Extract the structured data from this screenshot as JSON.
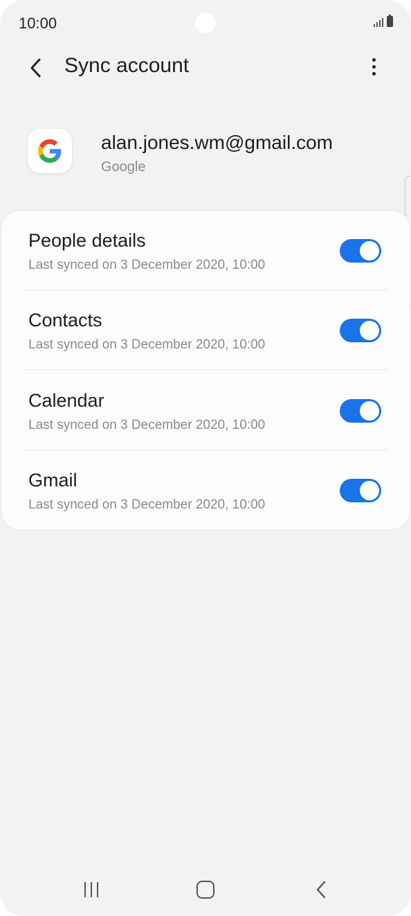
{
  "status_bar": {
    "time": "10:00",
    "signal_icon": "signal-bars-icon",
    "battery_icon": "battery-icon"
  },
  "app_bar": {
    "title": "Sync account",
    "back_icon": "chevron-left-icon",
    "more_icon": "more-vertical-icon"
  },
  "account": {
    "email": "alan.jones.wm@gmail.com",
    "type": "Google",
    "logo_icon": "google-logo-icon"
  },
  "sync_items": [
    {
      "label": "People details",
      "subtitle": "Last synced on 3 December 2020, 10:00",
      "enabled": true
    },
    {
      "label": "Contacts",
      "subtitle": "Last synced on 3 December 2020, 10:00",
      "enabled": true
    },
    {
      "label": "Calendar",
      "subtitle": "Last synced on 3 December 2020, 10:00",
      "enabled": true
    },
    {
      "label": "Gmail",
      "subtitle": "Last synced on 3 December 2020, 10:00",
      "enabled": true
    }
  ],
  "nav_bar": {
    "recents_icon": "recent-apps-icon",
    "home_icon": "home-icon",
    "back_icon": "back-icon"
  },
  "colors": {
    "background": "#f2f2f2",
    "card": "#fcfcfc",
    "toggle_on": "#1a73e8",
    "primary_text": "#1e1e1e",
    "secondary_text": "#8a8a8a"
  }
}
